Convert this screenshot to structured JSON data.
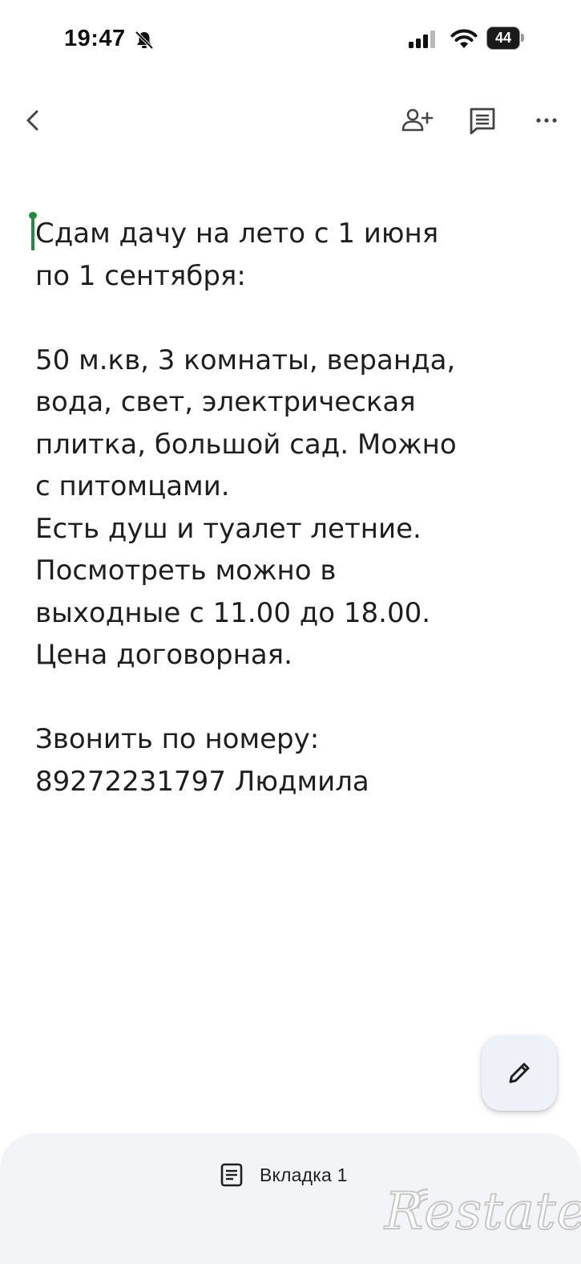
{
  "status_bar": {
    "time": "19:47",
    "battery": "44",
    "icons": [
      "bell-muted-icon",
      "signal-icon",
      "wifi-icon",
      "battery-icon"
    ]
  },
  "toolbar": {
    "icons": [
      "chevron-left-icon",
      "person-add-icon",
      "comment-icon",
      "more-horizontal-icon"
    ]
  },
  "document": {
    "lines": [
      "Сдам дачу на лето с 1 июня",
      "по 1 сентября:",
      "",
      "50 м.кв, 3 комнаты, веранда,",
      "вода, свет, электрическая",
      "плитка, большой сад. Можно",
      "с питомцами.",
      "Есть душ и туалет летние.",
      "Посмотреть можно в",
      "выходные с 11.00 до 18.00.",
      "Цена договорная.",
      "",
      "Звонить по номеру:",
      "89272231797 Людмила"
    ]
  },
  "fab": {
    "icon": "pencil-icon"
  },
  "bottom_tab": {
    "icon": "document-tab-icon",
    "label": "Вкладка 1"
  },
  "watermark": {
    "text": "Restate"
  }
}
